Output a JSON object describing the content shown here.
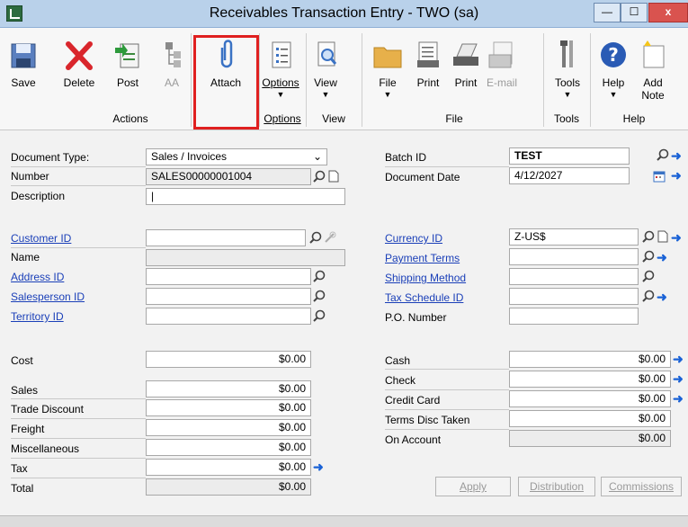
{
  "window": {
    "title": "Receivables Transaction Entry  -  TWO (sa)",
    "min": "—",
    "max": "☐",
    "close": "x"
  },
  "ribbon": {
    "save": "Save",
    "delete": "Delete",
    "post": "Post",
    "aa": "AA",
    "attach": "Attach",
    "options": "Options",
    "view": "View",
    "file": "File",
    "print1": "Print",
    "print2": "Print",
    "email": "E-mail",
    "tools": "Tools",
    "help": "Help",
    "add_note_1": "Add",
    "add_note_2": "Note",
    "dropdown_arrow": "▼",
    "groups": {
      "actions": "Actions",
      "options": "Options",
      "view": "View",
      "file": "File",
      "tools": "Tools",
      "help": "Help"
    }
  },
  "form": {
    "document_type_label": "Document Type:",
    "document_type_value": "Sales / Invoices",
    "number_label": "Number",
    "number_value": "SALES00000001004",
    "description_label": "Description",
    "description_value": "|",
    "batch_id_label": "Batch ID",
    "batch_id_value": "TEST",
    "document_date_label": "Document Date",
    "document_date_value": "4/12/2027",
    "customer_id_label": "Customer ID",
    "customer_id_value": "",
    "name_label": "Name",
    "address_id_label": "Address ID",
    "salesperson_id_label": "Salesperson ID",
    "territory_id_label": "Territory ID",
    "currency_id_label": "Currency ID",
    "currency_id_value": "Z-US$",
    "payment_terms_label": "Payment Terms",
    "shipping_method_label": "Shipping Method",
    "tax_schedule_label": "Tax Schedule ID",
    "po_number_label": "P.O. Number",
    "cost_label": "Cost",
    "cost_value": "$0.00",
    "sales_label": "Sales",
    "sales_value": "$0.00",
    "trade_discount_label": "Trade Discount",
    "trade_discount_value": "$0.00",
    "freight_label": "Freight",
    "freight_value": "$0.00",
    "misc_label": "Miscellaneous",
    "misc_value": "$0.00",
    "tax_label": "Tax",
    "tax_value": "$0.00",
    "total_label": "Total",
    "total_value": "$0.00",
    "cash_label": "Cash",
    "cash_value": "$0.00",
    "check_label": "Check",
    "check_value": "$0.00",
    "credit_card_label": "Credit Card",
    "credit_card_value": "$0.00",
    "terms_disc_label": "Terms Disc Taken",
    "terms_disc_value": "$0.00",
    "on_account_label": "On Account",
    "on_account_value": "$0.00",
    "apply_btn": "Apply",
    "distribution_btn": "Distribution",
    "commissions_btn": "Commissions"
  },
  "colors": {
    "title_bg": "#b9d1ea",
    "link": "#1a3fb8",
    "arrow": "#1a62d6",
    "highlight": "#e02020"
  }
}
